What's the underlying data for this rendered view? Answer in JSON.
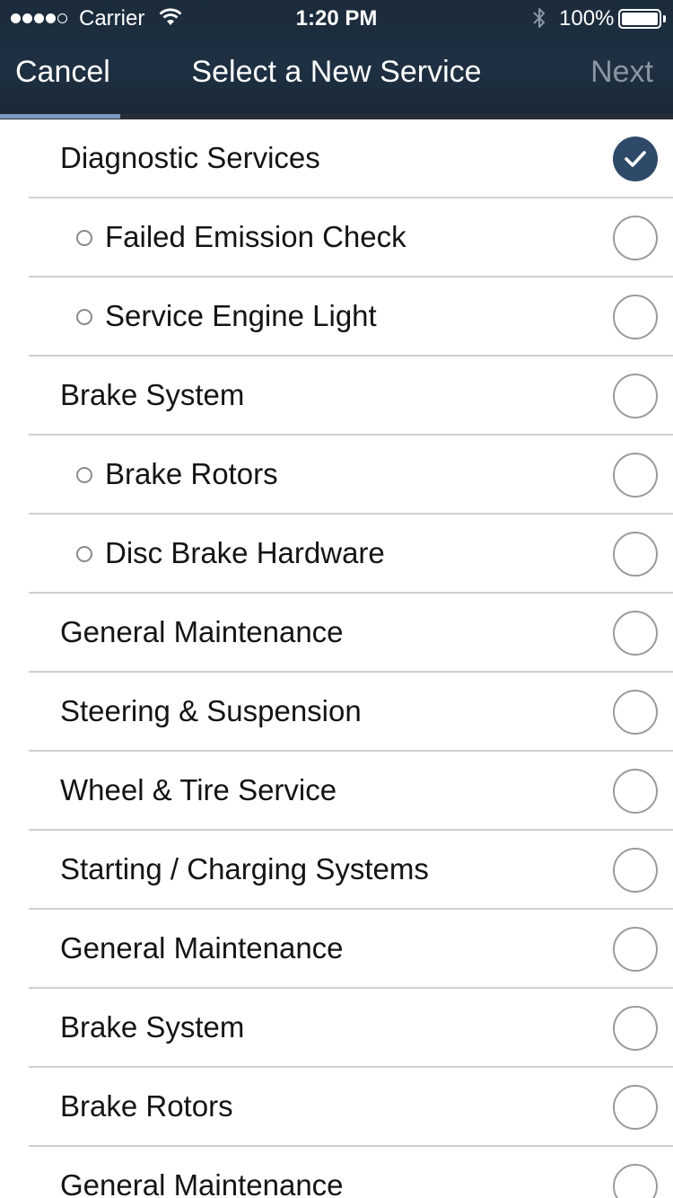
{
  "status_bar": {
    "carrier": "Carrier",
    "time": "1:20 PM",
    "battery": "100%",
    "signal_bars_filled": 4,
    "signal_bars_total": 5,
    "icons": [
      "signal-dots-icon",
      "wifi-icon",
      "bluetooth-icon",
      "battery-icon"
    ]
  },
  "nav": {
    "cancel_label": "Cancel",
    "title": "Select a New Service",
    "next_label": "Next"
  },
  "colors": {
    "header_bg": "#1e3042",
    "accent_underline": "#7a9bc4",
    "checked_radio": "#2f4a68",
    "next_disabled": "#8b96a3"
  },
  "services": [
    {
      "label": "Diagnostic Services",
      "sub": false,
      "checked": true
    },
    {
      "label": "Failed Emission Check",
      "sub": true,
      "checked": false
    },
    {
      "label": "Service Engine Light",
      "sub": true,
      "checked": false
    },
    {
      "label": "Brake System",
      "sub": false,
      "checked": false
    },
    {
      "label": "Brake Rotors",
      "sub": true,
      "checked": false
    },
    {
      "label": "Disc Brake Hardware",
      "sub": true,
      "checked": false
    },
    {
      "label": "General Maintenance",
      "sub": false,
      "checked": false
    },
    {
      "label": "Steering & Suspension",
      "sub": false,
      "checked": false
    },
    {
      "label": "Wheel & Tire Service",
      "sub": false,
      "checked": false
    },
    {
      "label": "Starting / Charging Systems",
      "sub": false,
      "checked": false
    },
    {
      "label": "General Maintenance",
      "sub": false,
      "checked": false
    },
    {
      "label": "Brake System",
      "sub": false,
      "checked": false
    },
    {
      "label": "Brake Rotors",
      "sub": false,
      "checked": false
    },
    {
      "label": "General Maintenance",
      "sub": false,
      "checked": false
    }
  ]
}
